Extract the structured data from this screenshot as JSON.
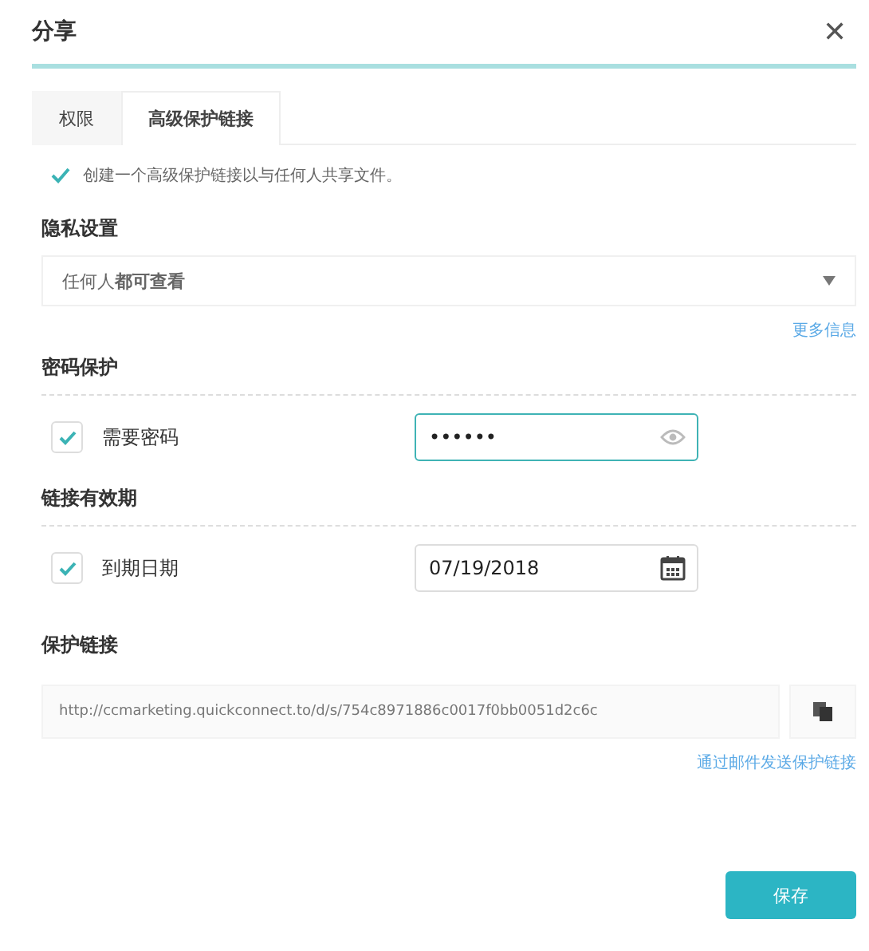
{
  "window": {
    "title": "分享",
    "close": "✕"
  },
  "tabs": [
    {
      "label": "权限",
      "selected": false
    },
    {
      "label": "高级保护链接",
      "selected": true
    }
  ],
  "notice": {
    "checked": true,
    "text": "创建一个高级保护链接以与任何人共享文件。"
  },
  "privacy": {
    "heading": "隐私设置",
    "value": "任何人**都可查看**",
    "more_link": "更多信息"
  },
  "password": {
    "heading": "密码保护",
    "label": "需要密码",
    "checked": true,
    "value": "••••••"
  },
  "expiry": {
    "heading": "链接有效期",
    "label": "到期日期",
    "checked": true,
    "value": "07/19/2018"
  },
  "protected_link": {
    "heading": "保护链接",
    "url": "http://ccmarketing.quickconnect.to/d/s/754c8971886c0017f0bb0051d2c6c",
    "email_link": "通过邮件发送保护链接"
  },
  "buttons": [
    {
      "label": "保存",
      "kind": "primary"
    }
  ]
}
